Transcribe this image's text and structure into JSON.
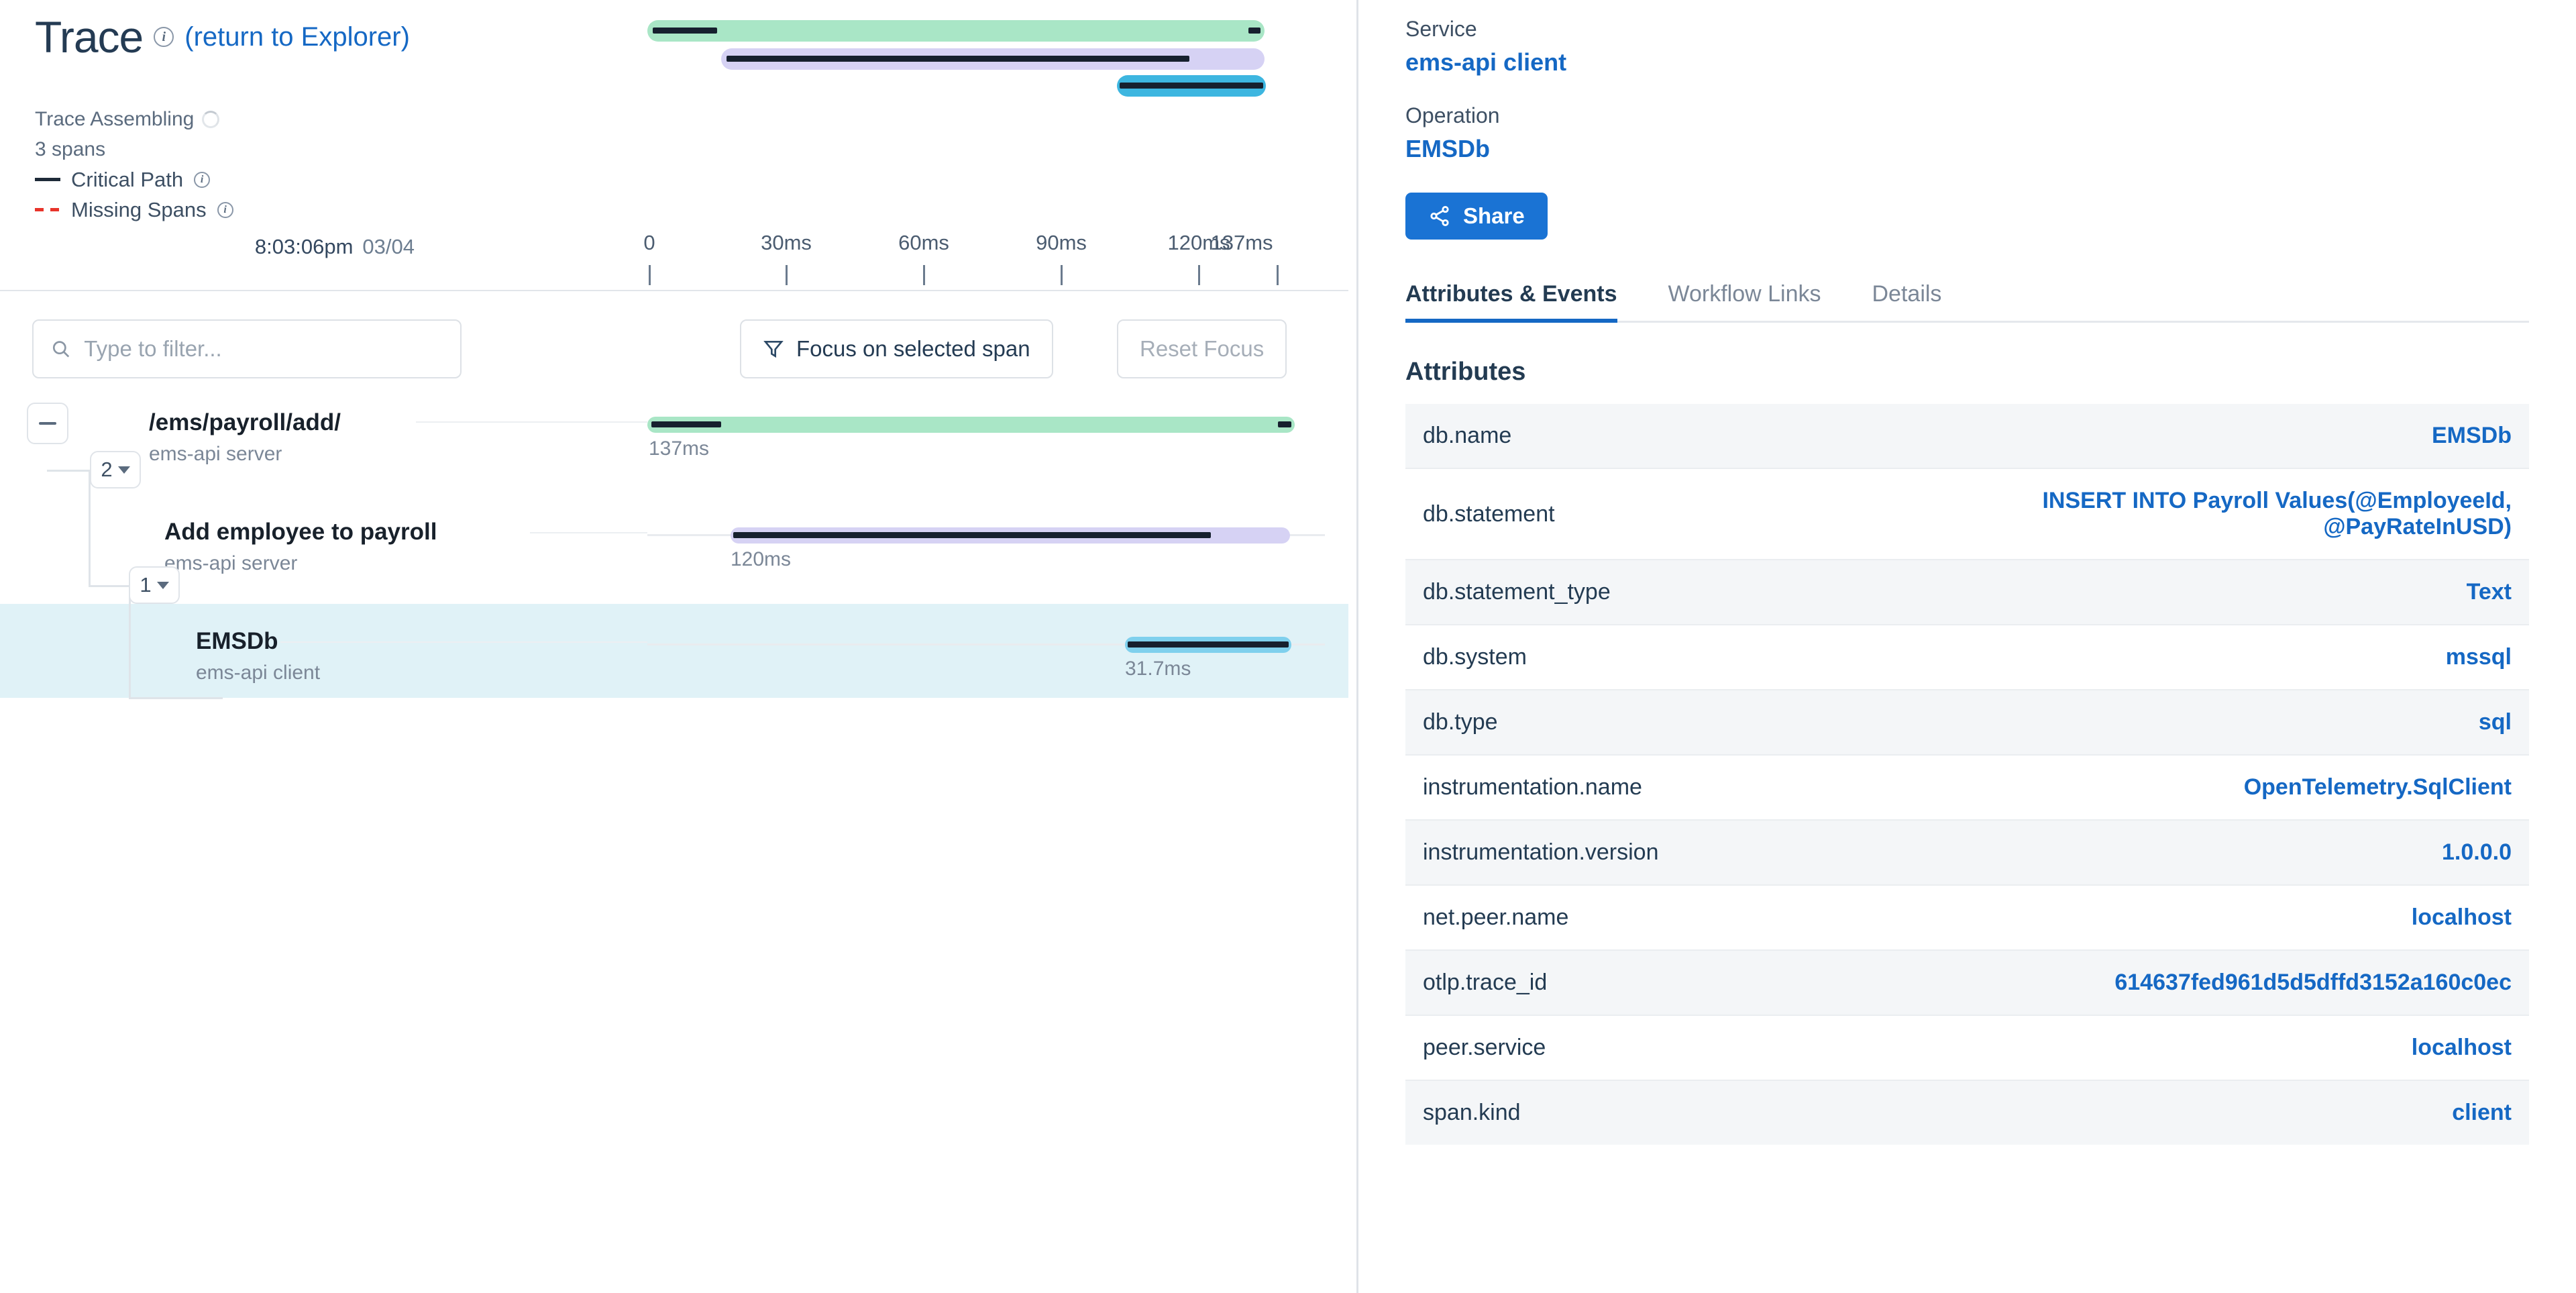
{
  "header": {
    "title": "Trace",
    "info_icon": "info-icon",
    "return_link": "(return to Explorer)",
    "status": "Trace Assembling",
    "span_count": "3 spans",
    "legend": [
      {
        "style": "solid",
        "label": "Critical Path",
        "icon": "info-icon"
      },
      {
        "style": "dashed",
        "label": "Missing Spans",
        "icon": "info-icon"
      }
    ]
  },
  "axis": {
    "start_time": "8:03:06pm",
    "start_date": "03/04",
    "ticks": [
      "0",
      "30ms",
      "60ms",
      "90ms",
      "120ms",
      "137ms"
    ],
    "total_ms": 137
  },
  "toolbar": {
    "filter_placeholder": "Type to filter...",
    "filter_value": "",
    "search_icon": "search-icon",
    "focus_icon": "filter-funnel-icon",
    "focus_label": "Focus on selected span",
    "reset_label": "Reset Focus"
  },
  "tree": {
    "collapse_all_icon": "minus-icon",
    "chips": [
      "2",
      "1"
    ]
  },
  "spans": [
    {
      "name": "/ems/payroll/add/",
      "service": "ems-api server",
      "duration": "137ms",
      "selected": false,
      "color": "#a9e6c6",
      "start_pct": 0,
      "width_pct": 100,
      "crit_start_pct": 0,
      "crit_width_pct": 10.5
    },
    {
      "name": "Add employee to payroll",
      "service": "ems-api server",
      "duration": "120ms",
      "selected": false,
      "color": "#d6d2f4",
      "start_pct": 13,
      "width_pct": 81,
      "crit_start_pct": 13,
      "crit_width_pct": 62
    },
    {
      "name": "EMSDb",
      "service": "ems-api client",
      "duration": "31.7ms",
      "selected": true,
      "color": "#7fd0ed",
      "start_pct": 71,
      "width_pct": 22,
      "crit_start_pct": 71,
      "crit_width_pct": 22
    }
  ],
  "details": {
    "service_label": "Service",
    "service_value": "ems-api client",
    "operation_label": "Operation",
    "operation_value": "EMSDb",
    "share_icon": "share-nodes-icon",
    "share_label": "Share",
    "tabs": [
      {
        "label": "Attributes & Events",
        "active": true
      },
      {
        "label": "Workflow Links",
        "active": false
      },
      {
        "label": "Details",
        "active": false
      }
    ],
    "attributes_title": "Attributes",
    "attributes": [
      {
        "key": "db.name",
        "value": "EMSDb"
      },
      {
        "key": "db.statement",
        "value": "INSERT INTO Payroll Values(@EmployeeId, @PayRateInUSD)"
      },
      {
        "key": "db.statement_type",
        "value": "Text"
      },
      {
        "key": "db.system",
        "value": "mssql"
      },
      {
        "key": "db.type",
        "value": "sql"
      },
      {
        "key": "instrumentation.name",
        "value": "OpenTelemetry.SqlClient"
      },
      {
        "key": "instrumentation.version",
        "value": "1.0.0.0"
      },
      {
        "key": "net.peer.name",
        "value": "localhost"
      },
      {
        "key": "otlp.trace_id",
        "value": "614637fed961d5d5dffd3152a160c0ec"
      },
      {
        "key": "peer.service",
        "value": "localhost"
      },
      {
        "key": "span.kind",
        "value": "client"
      }
    ]
  },
  "colors": {
    "accent": "#1568c4",
    "share_bg": "#1a73d4",
    "selected_row": "#e0f2f7",
    "critical_path": "#16202e",
    "missing_spans": "#e8342a"
  }
}
